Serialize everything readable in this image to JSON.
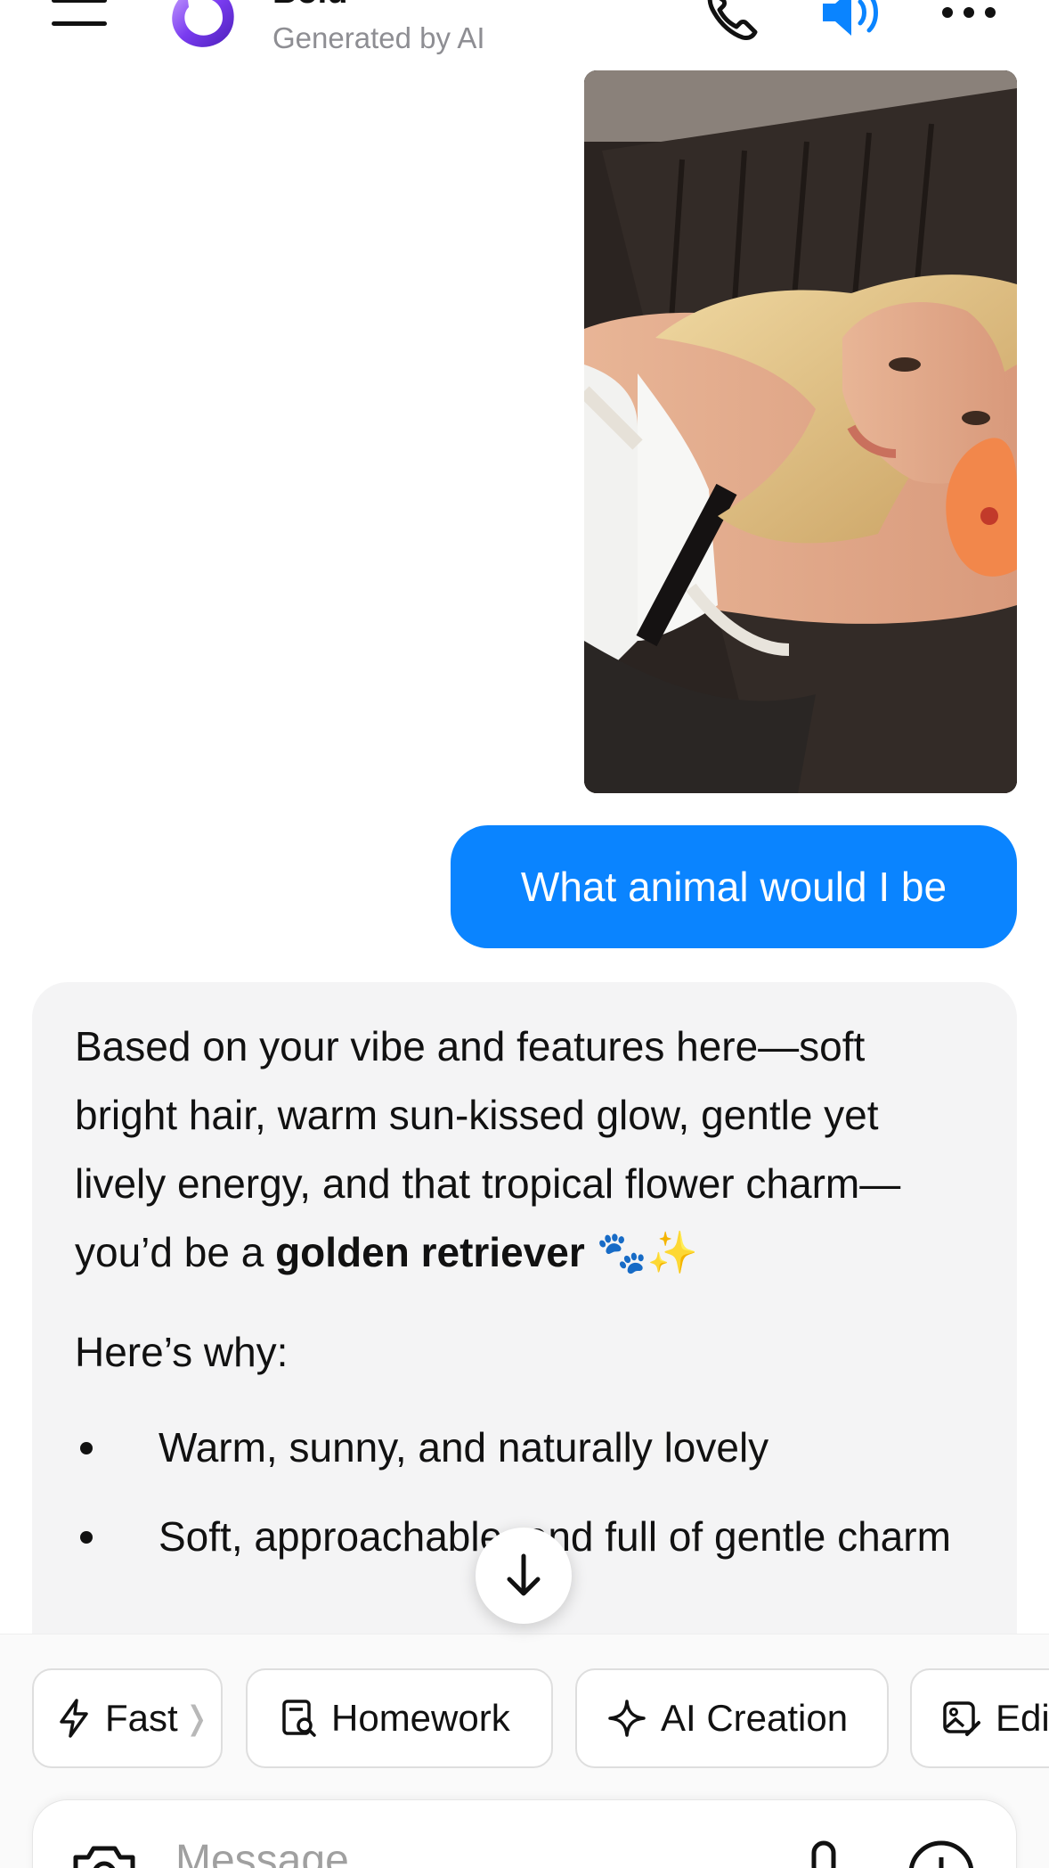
{
  "header": {
    "bot_name": "Bold",
    "bot_subtitle": "Generated by AI",
    "icons": [
      "menu-icon",
      "bot-avatar-logo",
      "phone-icon",
      "speaker-icon",
      "more-icon"
    ]
  },
  "chat": {
    "user_photo_alt": "photo",
    "user_message": "What animal would I be",
    "ai_intro_1": "Based on your vibe and features here—soft bright hair, warm sun-kissed glow, gentle yet lively energy, and that tropical flower charm—you’d be a ",
    "ai_bold": "golden retriever",
    "ai_emoji": " 🐾✨",
    "ai_why": "Here’s why:",
    "bullets": [
      "Warm, sunny, and naturally lovely",
      "Soft, approachable, and full of gentle charm"
    ],
    "scroll_icon": "arrow-down-icon"
  },
  "chips": [
    {
      "label": "Fast",
      "icon": "bolt-icon"
    },
    {
      "label": "Homework",
      "icon": "homework-icon"
    },
    {
      "label": "AI Creation",
      "icon": "sparkle-icon"
    },
    {
      "label": "Edit",
      "icon": "edit-image-icon"
    }
  ],
  "composer": {
    "placeholder": "Message",
    "icons": [
      "camera-icon",
      "mic-icon",
      "plus-icon"
    ]
  },
  "colors": {
    "accent": "#0a84ff",
    "card_bg": "#f4f4f5",
    "muted_text": "#8e8e93"
  }
}
